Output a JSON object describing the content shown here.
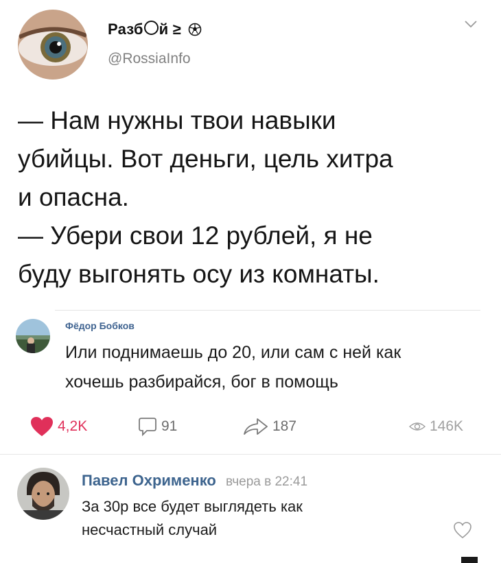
{
  "tweet": {
    "author_name": "Разб",
    "author_name_suffix": "й ≥",
    "author_handle": "@RossiaInfo",
    "text_lines": [
      "— Нам нужны твои навыки",
      "убийцы. Вот деньги, цель хитра",
      "и опасна.",
      "— Убери свои 12 рублей, я не",
      "буду выгонять осу из комнаты."
    ]
  },
  "comment": {
    "author": "Фёдор Бобков",
    "text_lines": [
      "Или поднимаешь до 20, или сам с ней как",
      "хочешь разбирайся, бог в помощь"
    ]
  },
  "actions": {
    "likes": "4,2K",
    "comments": "91",
    "shares": "187",
    "views": "146K"
  },
  "reply": {
    "author": "Павел Охрименко",
    "time": "вчера в 22:41",
    "text_lines": [
      "За 30р все будет выглядеть как",
      "несчастный случай"
    ]
  },
  "colors": {
    "like_red": "#e0305a",
    "link_blue": "#3d648e",
    "muted_gray": "#9a9a9a"
  },
  "icons": [
    "eye-avatar",
    "soccer-ball-icon",
    "chevron-down-icon",
    "heart-icon",
    "comment-icon",
    "share-icon",
    "eye-icon"
  ]
}
